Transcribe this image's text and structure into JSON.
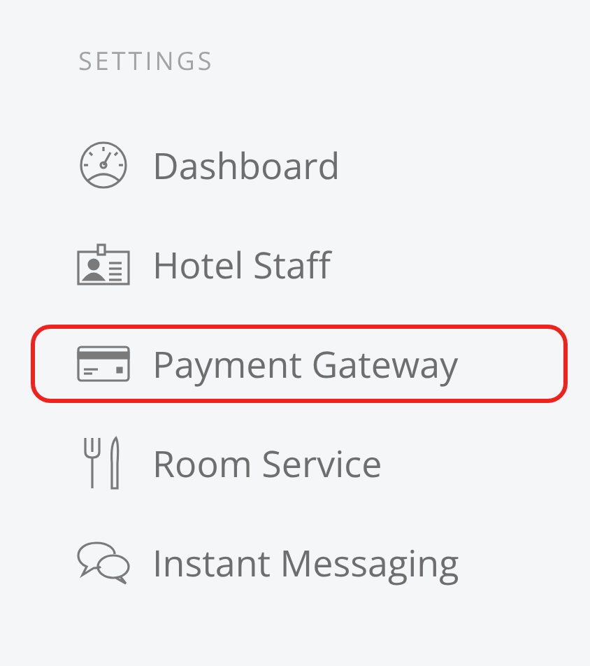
{
  "section": {
    "title": "SETTINGS"
  },
  "items": [
    {
      "kind": "gauge",
      "label": "Dashboard",
      "highlighted": false
    },
    {
      "kind": "badge",
      "label": "Hotel Staff",
      "highlighted": false
    },
    {
      "kind": "card",
      "label": "Payment Gateway",
      "highlighted": true
    },
    {
      "kind": "cutlery",
      "label": "Room Service",
      "highlighted": false
    },
    {
      "kind": "chat",
      "label": "Instant Messaging",
      "highlighted": false
    }
  ]
}
